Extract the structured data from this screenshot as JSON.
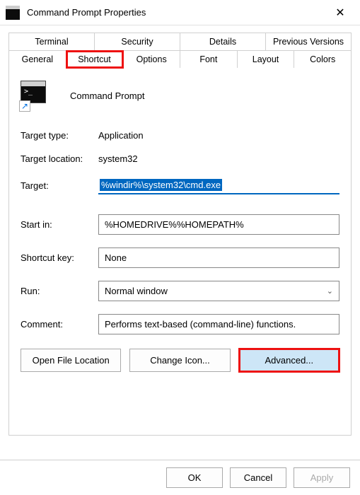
{
  "window": {
    "title": "Command Prompt Properties"
  },
  "tabs": {
    "row1": [
      "Terminal",
      "Security",
      "Details",
      "Previous Versions"
    ],
    "row2": [
      "General",
      "Shortcut",
      "Options",
      "Font",
      "Layout",
      "Colors"
    ],
    "active": "Shortcut"
  },
  "app": {
    "name": "Command Prompt"
  },
  "fields": {
    "target_type_label": "Target type:",
    "target_type_value": "Application",
    "target_location_label": "Target location:",
    "target_location_value": "system32",
    "target_label": "Target:",
    "target_value": "%windir%\\system32\\cmd.exe",
    "start_in_label": "Start in:",
    "start_in_value": "%HOMEDRIVE%%HOMEPATH%",
    "shortcut_key_label": "Shortcut key:",
    "shortcut_key_value": "None",
    "run_label": "Run:",
    "run_value": "Normal window",
    "comment_label": "Comment:",
    "comment_value": "Performs text-based (command-line) functions."
  },
  "buttons": {
    "open_file_location": "Open File Location",
    "change_icon": "Change Icon...",
    "advanced": "Advanced..."
  },
  "dialog": {
    "ok": "OK",
    "cancel": "Cancel",
    "apply": "Apply"
  }
}
